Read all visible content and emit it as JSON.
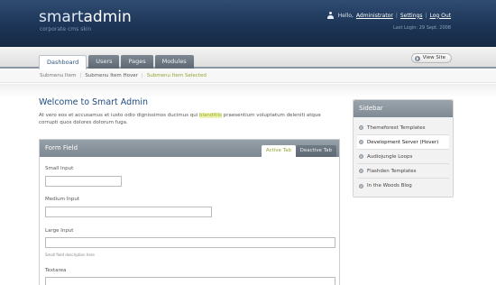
{
  "header": {
    "logo_prefix": "smart",
    "logo_suffix": "admin",
    "tagline": "corporate cms skin",
    "greeting": "Hello,",
    "username": "Administrator",
    "settings_label": "Settings",
    "logout_label": "Log Out",
    "last_login": "Last Login: 29 Sept. 2008"
  },
  "nav": {
    "tabs": [
      {
        "label": "Dashboard",
        "active": true
      },
      {
        "label": "Users",
        "active": false
      },
      {
        "label": "Pages",
        "active": false
      },
      {
        "label": "Modules",
        "active": false
      }
    ],
    "view_site_label": "View Site"
  },
  "submenu": {
    "items": [
      {
        "label": "Submenu Item",
        "state": "normal"
      },
      {
        "label": "Submenu Item Hover",
        "state": "hover"
      },
      {
        "label": "Submenu Item Selected",
        "state": "selected"
      }
    ]
  },
  "main": {
    "welcome_title": "Welcome to Smart Admin",
    "intro_before": "At vero eos et accusamus et iusto odio dignissimos ducimus qui",
    "intro_highlight": "blanditiis",
    "intro_after": "praesentium voluptatum deleniti atque corrupti quos dolores dolorum fuga."
  },
  "form_panel": {
    "title": "Form Field",
    "active_tab": "Active Tab",
    "inactive_tab": "Deactive Tab",
    "fields": [
      {
        "label": "Small Input",
        "value": ""
      },
      {
        "label": "Medium Input",
        "value": ""
      },
      {
        "label": "Large Input",
        "value": ""
      },
      {
        "label": "Textarea",
        "value": ""
      }
    ],
    "field_description": "Small field description here"
  },
  "sidebar": {
    "title": "Sidebar",
    "items": [
      {
        "label": "Themeforest Templates"
      },
      {
        "label": "Development Server (Hover)"
      },
      {
        "label": "Audiojungle Loops"
      },
      {
        "label": "Flashden Templates"
      },
      {
        "label": "In the Woods Blog"
      }
    ]
  }
}
